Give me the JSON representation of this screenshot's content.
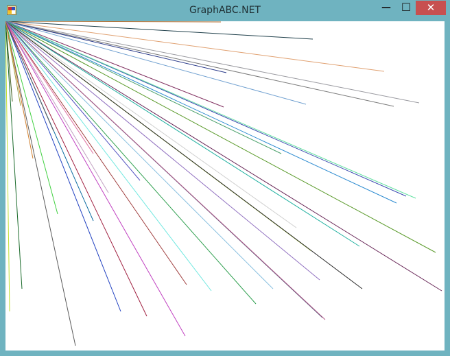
{
  "window": {
    "title": "GraphABC.NET",
    "frame_color": "#6fb3c0",
    "close_color": "#c75050",
    "controls": {
      "minimize_icon": "minimize-icon",
      "maximize_icon": "maximize-icon",
      "close_icon": "close-icon",
      "minimize_glyph": "—",
      "maximize_glyph": "☐",
      "close_glyph": "✕"
    }
  },
  "canvas": {
    "background": "#ffffff",
    "line_colors": [
      "#b86b2a",
      "#1f3f4a",
      "#e0a070",
      "#9a9aa0",
      "#7a7a7a",
      "#2a3a8a",
      "#70a0d0",
      "#803060",
      "#4aa06a",
      "#3a4ab0",
      "#60e0a0",
      "#2a8ad0",
      "#5a9a2a",
      "#6a2a5a",
      "#20b0a0",
      "#b0d040",
      "#d0d0d0",
      "#9070c0",
      "#2a2a2a",
      "#405070",
      "#b05a8a",
      "#8ac0e0",
      "#30a050",
      "#70e8e0",
      "#a04040",
      "#5050c0",
      "#c0a0c0",
      "#e070a0",
      "#0a6aa0",
      "#40d040",
      "#a0a040",
      "#3a5a1a",
      "#c0e030",
      "#1a6a2a",
      "#5a5a5a",
      "#2040c0",
      "#a02040",
      "#c040c0",
      "#606060",
      "#d08030"
    ]
  }
}
